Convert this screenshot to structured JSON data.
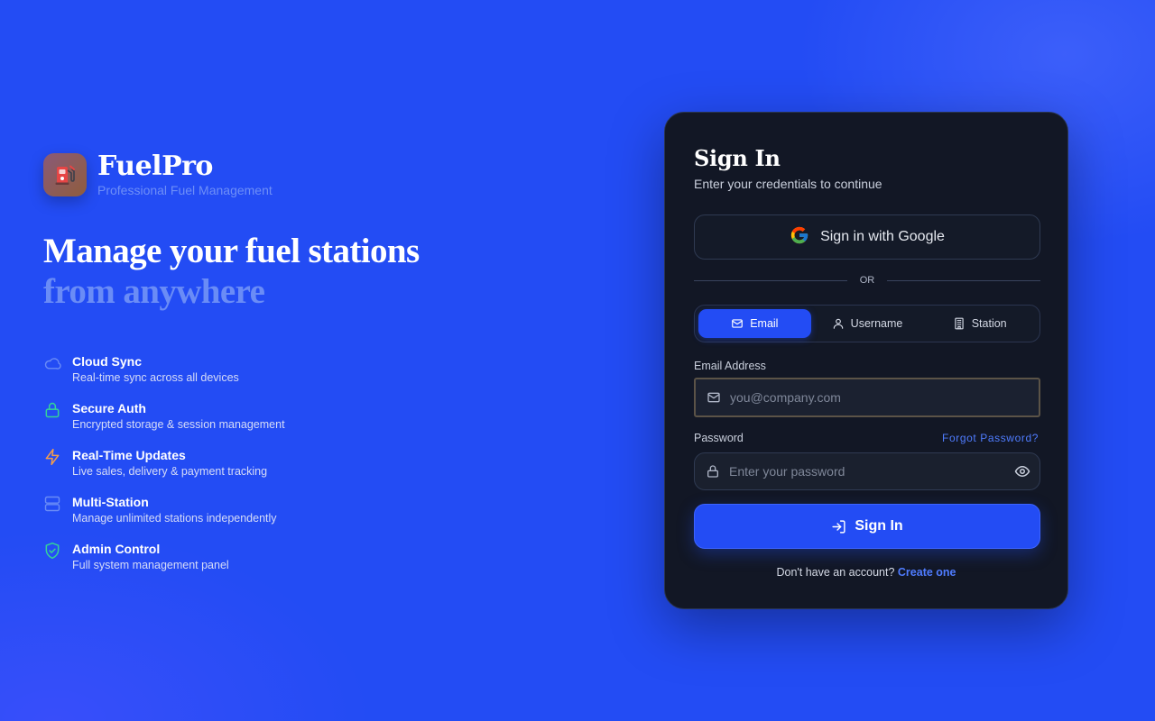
{
  "brand": {
    "name": "FuelPro",
    "tagline": "Professional Fuel Management"
  },
  "hero": {
    "line1": "Manage your fuel stations",
    "line2": "from anywhere"
  },
  "features": [
    {
      "icon": "cloud-icon",
      "title": "Cloud Sync",
      "desc": "Real-time sync across all devices",
      "color": "#6a8cf6"
    },
    {
      "icon": "lock-icon",
      "title": "Secure Auth",
      "desc": "Encrypted storage & session management",
      "color": "#34d399"
    },
    {
      "icon": "lightning-icon",
      "title": "Real-Time Updates",
      "desc": "Live sales, delivery & payment tracking",
      "color": "#f59e4b"
    },
    {
      "icon": "server-icon",
      "title": "Multi-Station",
      "desc": "Manage unlimited stations independently",
      "color": "#6a8cf6"
    },
    {
      "icon": "shield-check-icon",
      "title": "Admin Control",
      "desc": "Full system management panel",
      "color": "#34d399"
    }
  ],
  "card": {
    "title": "Sign In",
    "subtitle": "Enter your credentials to continue",
    "google_label": "Sign in with Google",
    "divider": "OR",
    "tabs": [
      {
        "label": "Email",
        "icon": "mail-icon",
        "active": true
      },
      {
        "label": "Username",
        "icon": "user-icon",
        "active": false
      },
      {
        "label": "Station",
        "icon": "building-icon",
        "active": false
      }
    ],
    "email_label": "Email Address",
    "email_placeholder": "you@company.com",
    "email_value": "",
    "password_label": "Password",
    "forgot_label": "Forgot Password?",
    "password_placeholder": "Enter your password",
    "password_value": "",
    "submit_label": "Sign In",
    "signup_prompt": "Don't have an account?",
    "signup_link": "Create one"
  },
  "colors": {
    "background": "#234cf4",
    "card": "#121725",
    "accent": "#234cf4",
    "link": "#4f7cff"
  }
}
